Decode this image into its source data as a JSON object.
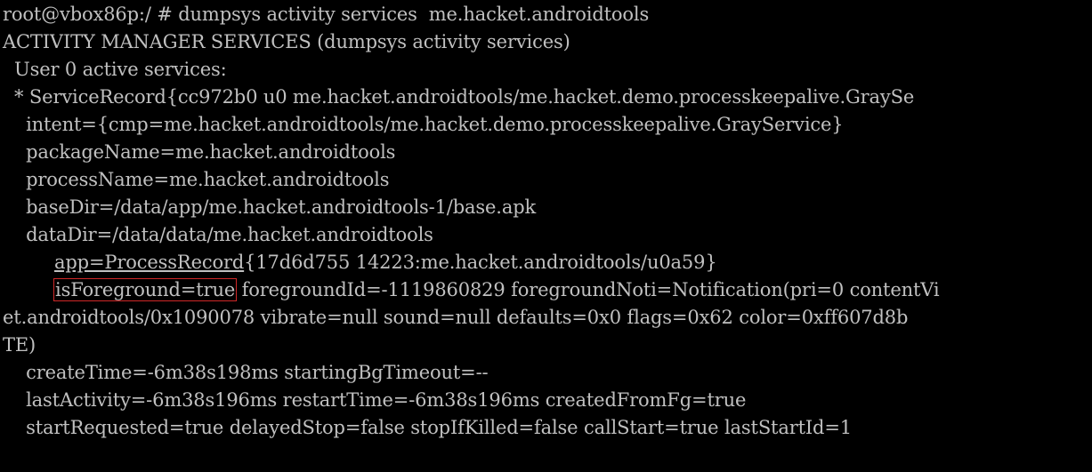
{
  "terminal": {
    "lines": [
      "root@vbox86p:/ # dumpsys activity services  me.hacket.androidtools",
      "ACTIVITY MANAGER SERVICES (dumpsys activity services)",
      "  User 0 active services:",
      "  * ServiceRecord{cc972b0 u0 me.hacket.androidtools/me.hacket.demo.processkeepalive.GraySe",
      "    intent={cmp=me.hacket.androidtools/me.hacket.demo.processkeepalive.GrayService}",
      "    packageName=me.hacket.androidtools",
      "    processName=me.hacket.androidtools",
      "    baseDir=/data/app/me.hacket.androidtools-1/base.apk",
      "    dataDir=/data/data/me.hacket.androidtools",
      "    app=ProcessRecord{17d6d755 14223:me.hacket.androidtools/u0a59}",
      "et.androidtools/0x1090078 vibrate=null sound=null defaults=0x0 flags=0x62 color=0xff607d8b",
      "TE)",
      "    createTime=-6m38s198ms startingBgTimeout=--",
      "    lastActivity=-6m38s196ms restartTime=-6m38s196ms createdFromFg=true",
      "    startRequested=true delayedStop=false stopIfKilled=false callStart=true lastStartId=1"
    ],
    "highlight_line": {
      "boxed": "isForeground=true",
      "rest": " foregroundId=-1119860829 foregroundNoti=Notification(pri=0 contentVi"
    },
    "app_line": {
      "prefix": "app=ProcessRecord",
      "rest": "{17d6d755 14223:me.hacket.androidtools/u0a59}"
    },
    "colors": {
      "background": "#000000",
      "text": "#c0c0c0",
      "highlight_border": "#d02828"
    }
  }
}
